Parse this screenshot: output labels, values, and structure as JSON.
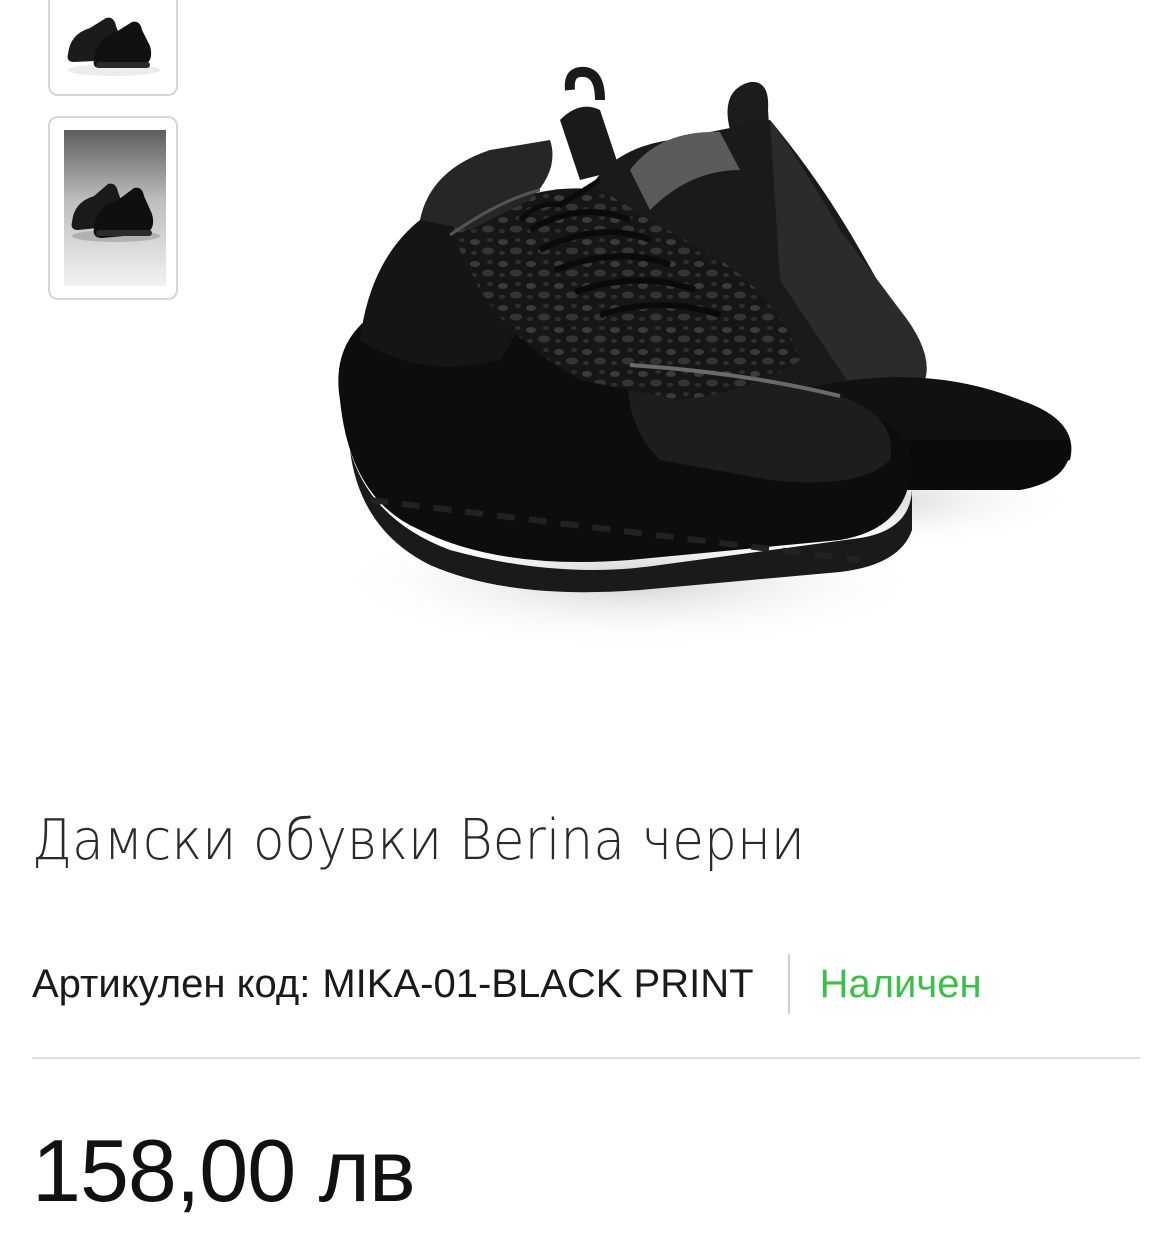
{
  "gallery": {
    "thumbnails": [
      {
        "icon": "sneaker-pair-thumbnail"
      },
      {
        "icon": "sneaker-pair-thumbnail-studio"
      }
    ],
    "main_image": {
      "icon": "black-chunky-sneakers-photo"
    }
  },
  "product": {
    "title": "Дамски обувки Berina черни",
    "sku_label": "Артикулен код:",
    "sku_value": "MIKA-01-BLACK PRINT",
    "availability": "Наличен",
    "price": "158,00 лв"
  },
  "colors": {
    "availability_green": "#3cbf4a",
    "divider": "#dedede",
    "thumb_border": "#d6d6d6"
  }
}
